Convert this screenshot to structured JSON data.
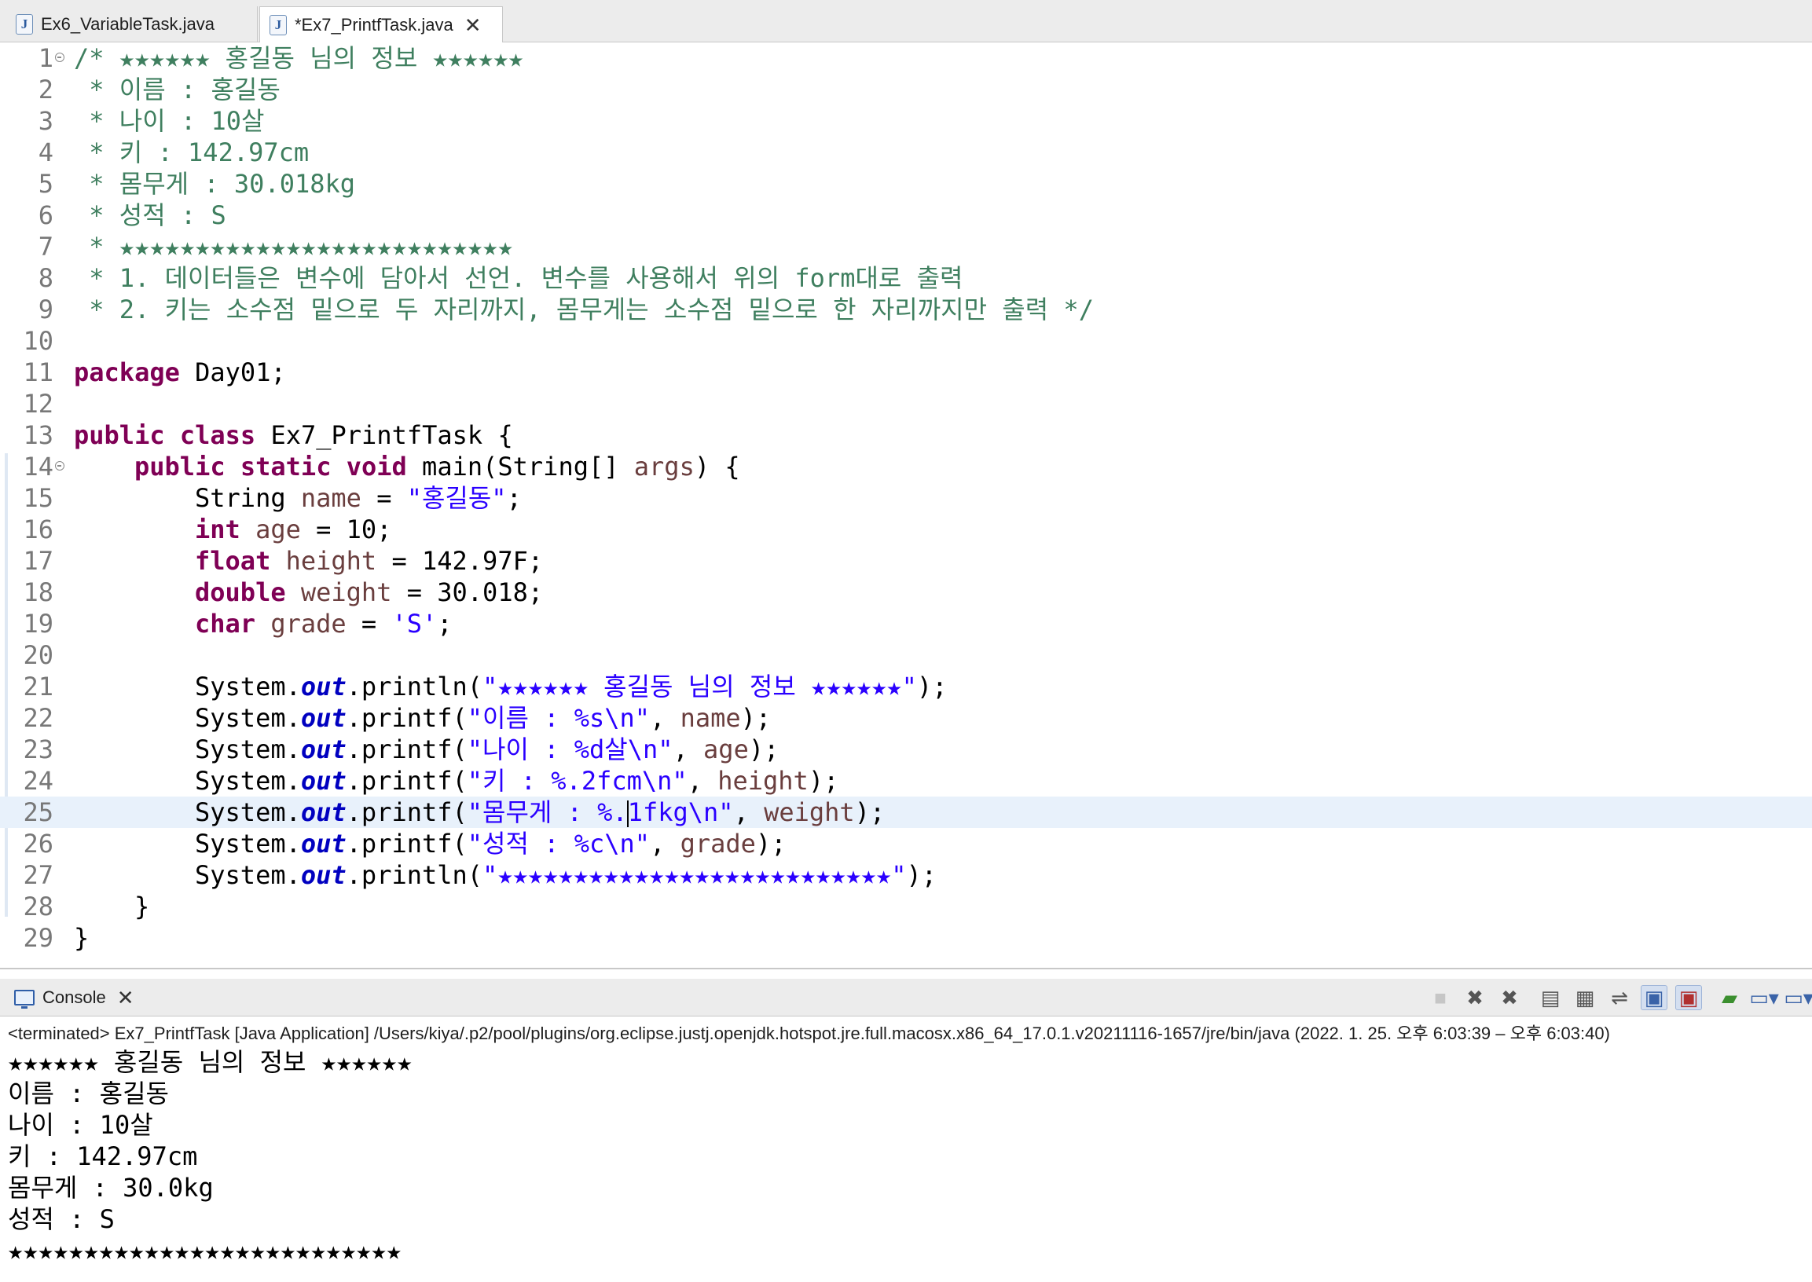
{
  "editor_tabs": [
    {
      "label": "Ex6_VariableTask.java",
      "icon": "java-file-icon"
    },
    {
      "label": "*Ex7_PrintfTask.java",
      "icon": "java-file-icon",
      "active": true
    }
  ],
  "code": {
    "line_numbers": [
      "1",
      "2",
      "3",
      "4",
      "5",
      "6",
      "7",
      "8",
      "9",
      "10",
      "11",
      "12",
      "13",
      "14",
      "15",
      "16",
      "17",
      "18",
      "19",
      "20",
      "21",
      "22",
      "23",
      "24",
      "25",
      "26",
      "27",
      "28",
      "29"
    ],
    "comment_lines": [
      "/* ★★★★★★ 홍길동 님의 정보 ★★★★★★",
      " * 이름 : 홍길동",
      " * 나이 : 10살",
      " * 키 : 142.97cm",
      " * 몸무게 : 30.018kg",
      " * 성적 : S",
      " * ★★★★★★★★★★★★★★★★★★★★★★★★★★",
      " * 1. 데이터들은 변수에 담아서 선언. 변수를 사용해서 위의 form대로 출력",
      " * 2. 키는 소수점 밑으로 두 자리까지, 몸무게는 소수점 밑으로 한 자리까지만 출력 */"
    ],
    "package_kw": "package",
    "package_name": " Day01;",
    "class_kw1": "public",
    "class_kw2": "class",
    "class_rest": " Ex7_PrintfTask {",
    "main_kw1": "public",
    "main_kw2": "static",
    "main_kw3": "void",
    "main_rest1": " main(String[] ",
    "main_var": "args",
    "main_rest2": ") {",
    "decl": [
      {
        "type": "String",
        "type_is_kw": false,
        "var": "name",
        "op": " = ",
        "val": "\"홍길동\"",
        "val_is_str": true
      },
      {
        "type": "int",
        "type_is_kw": true,
        "var": "age",
        "op": " = ",
        "val": "10",
        "val_is_str": false
      },
      {
        "type": "float",
        "type_is_kw": true,
        "var": "height",
        "op": " = ",
        "val": "142.97F",
        "val_is_str": false
      },
      {
        "type": "double",
        "type_is_kw": true,
        "var": "weight",
        "op": " = ",
        "val": "30.018",
        "val_is_str": false
      },
      {
        "type": "char",
        "type_is_kw": true,
        "var": "grade",
        "op": " = ",
        "val": "'S'",
        "val_is_str": true
      }
    ],
    "sys": "System.",
    "out": "out",
    "println": ".println(",
    "printf": ".printf(",
    "stmt_end": ");",
    "print_title": "\"★★★★★★ 홍길동 님의 정보 ★★★★★★\"",
    "print_name_fmt": "\"이름 : %s\\n\"",
    "print_age_fmt": "\"나이 : %d살\\n\"",
    "print_height_fmt": "\"키 : %.2fcm\\n\"",
    "print_weight_fmt_a": "\"몸무게 : %.",
    "print_weight_fmt_b": "1fkg\\n\"",
    "print_grade_fmt": "\"성적 : %c\\n\"",
    "print_stars": "\"★★★★★★★★★★★★★★★★★★★★★★★★★★\"",
    "arg_sep": ", ",
    "arg_name": "name",
    "arg_age": "age",
    "arg_height": "height",
    "arg_weight": "weight",
    "arg_grade": "grade",
    "close_method": "}",
    "close_class": "}"
  },
  "console": {
    "tab_label": "Console",
    "path": "<terminated> Ex7_PrintfTask [Java Application] /Users/kiya/.p2/pool/plugins/org.eclipse.justj.openjdk.hotspot.jre.full.macosx.x86_64_17.0.1.v20211116-1657/jre/bin/java  (2022. 1. 25. 오후 6:03:39 – 오후 6:03:40)",
    "output": [
      "★★★★★★ 홍길동 님의 정보 ★★★★★★",
      "이름 : 홍길동",
      "나이 : 10살",
      "키 : 142.97cm",
      "몸무게 : 30.0kg",
      "성적 : S",
      "★★★★★★★★★★★★★★★★★★★★★★★★★★"
    ],
    "toolbar_icons": [
      "terminate-icon",
      "remove-launch-icon",
      "remove-all-terminated-icon",
      "clear-console-icon",
      "scroll-lock-icon",
      "word-wrap-icon",
      "show-on-stdout-icon",
      "show-on-stderr-icon",
      "pin-console-icon",
      "display-selected-console-icon",
      "open-console-icon"
    ]
  }
}
